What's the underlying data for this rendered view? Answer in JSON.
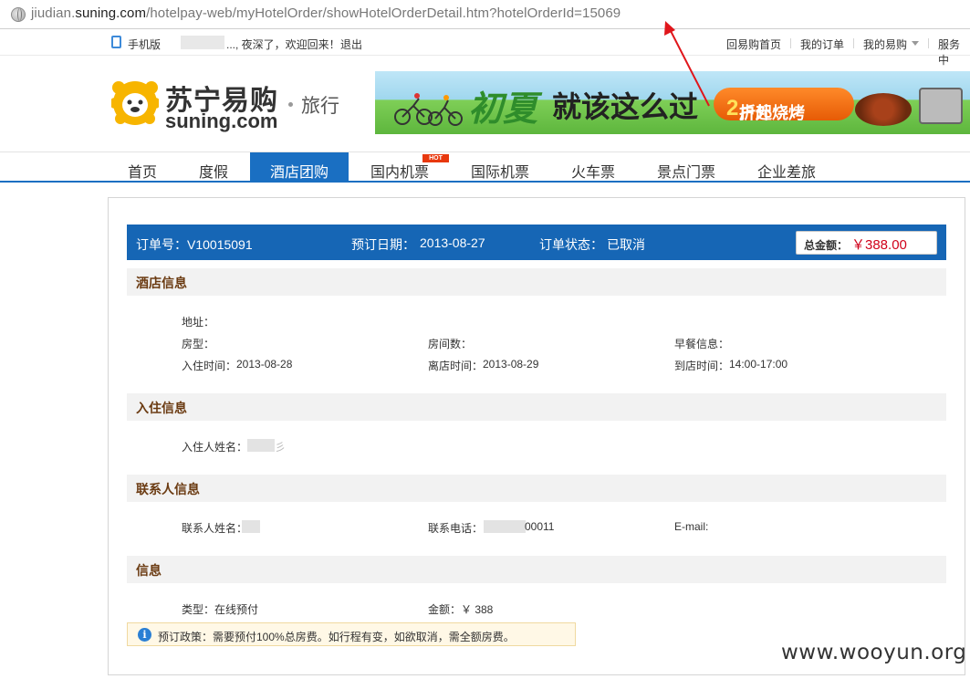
{
  "browser": {
    "url_host_prefix": "jiudian.",
    "url_host_main": "suning.com",
    "url_path": "/hotelpay-web/myHotelOrder/showHotelOrderDetail.htm?hotelOrderId=15069"
  },
  "topbar": {
    "mobile": "手机版",
    "welcome": "..., 夜深了，欢迎回来！",
    "logout": "退出",
    "links": [
      "回易购首页",
      "我的订单",
      "我的易购",
      "服务中"
    ]
  },
  "header": {
    "logo_cn": "苏宁易购",
    "logo_en": "suning.com",
    "sub_brand": "旅行",
    "banner": {
      "cursive": "初夏",
      "main": "就该这么过",
      "promo_prefix": "户外烧烤",
      "promo_number": "2",
      "promo_suffix": "折起"
    }
  },
  "nav": {
    "items": [
      "首页",
      "度假",
      "酒店团购",
      "国内机票",
      "国际机票",
      "火车票",
      "景点门票",
      "企业差旅"
    ],
    "hot_badge": "HOT",
    "active_index": 2
  },
  "order": {
    "number_label": "订单号：V10015091",
    "date_label": "预订日期：",
    "date": "2013-08-27",
    "status_label": "订单状态：",
    "status": "已取消",
    "total_label": "总金额：",
    "total": "￥388.00"
  },
  "hotel_info": {
    "title": "酒店信息",
    "address_label": "地址：",
    "room_type_label": "房型：",
    "room_count_label": "房间数：",
    "breakfast_label": "早餐信息：",
    "checkin_label": "入住时间：",
    "checkin": "2013-08-28",
    "checkout_label": "离店时间：",
    "checkout": "2013-08-29",
    "arrival_label": "到店时间：",
    "arrival": "14:00-17:00"
  },
  "guest_info": {
    "title": "入住信息",
    "name_label": "入住人姓名：",
    "name_tail": "彡"
  },
  "contact_info": {
    "title": "联系人信息",
    "name_label": "联系人姓名：",
    "phone_label": "联系电话：",
    "phone_tail": "00011",
    "email_label": "E-mail:"
  },
  "payment_info": {
    "title": "信息",
    "type_label": "类型：",
    "type": "在线预付",
    "amount_label": "金额：",
    "amount": "￥ 388"
  },
  "policy": {
    "icon": "info-icon",
    "text": "预订政策：需要预付100%总房费。如行程有变，如欲取消，需全额房费。"
  },
  "watermark": "www.wooyun.org",
  "colors": {
    "brand_blue": "#1666b5",
    "price_red": "#d0021b",
    "section_title": "#6b3b12",
    "annotation_red": "#e0161b"
  }
}
